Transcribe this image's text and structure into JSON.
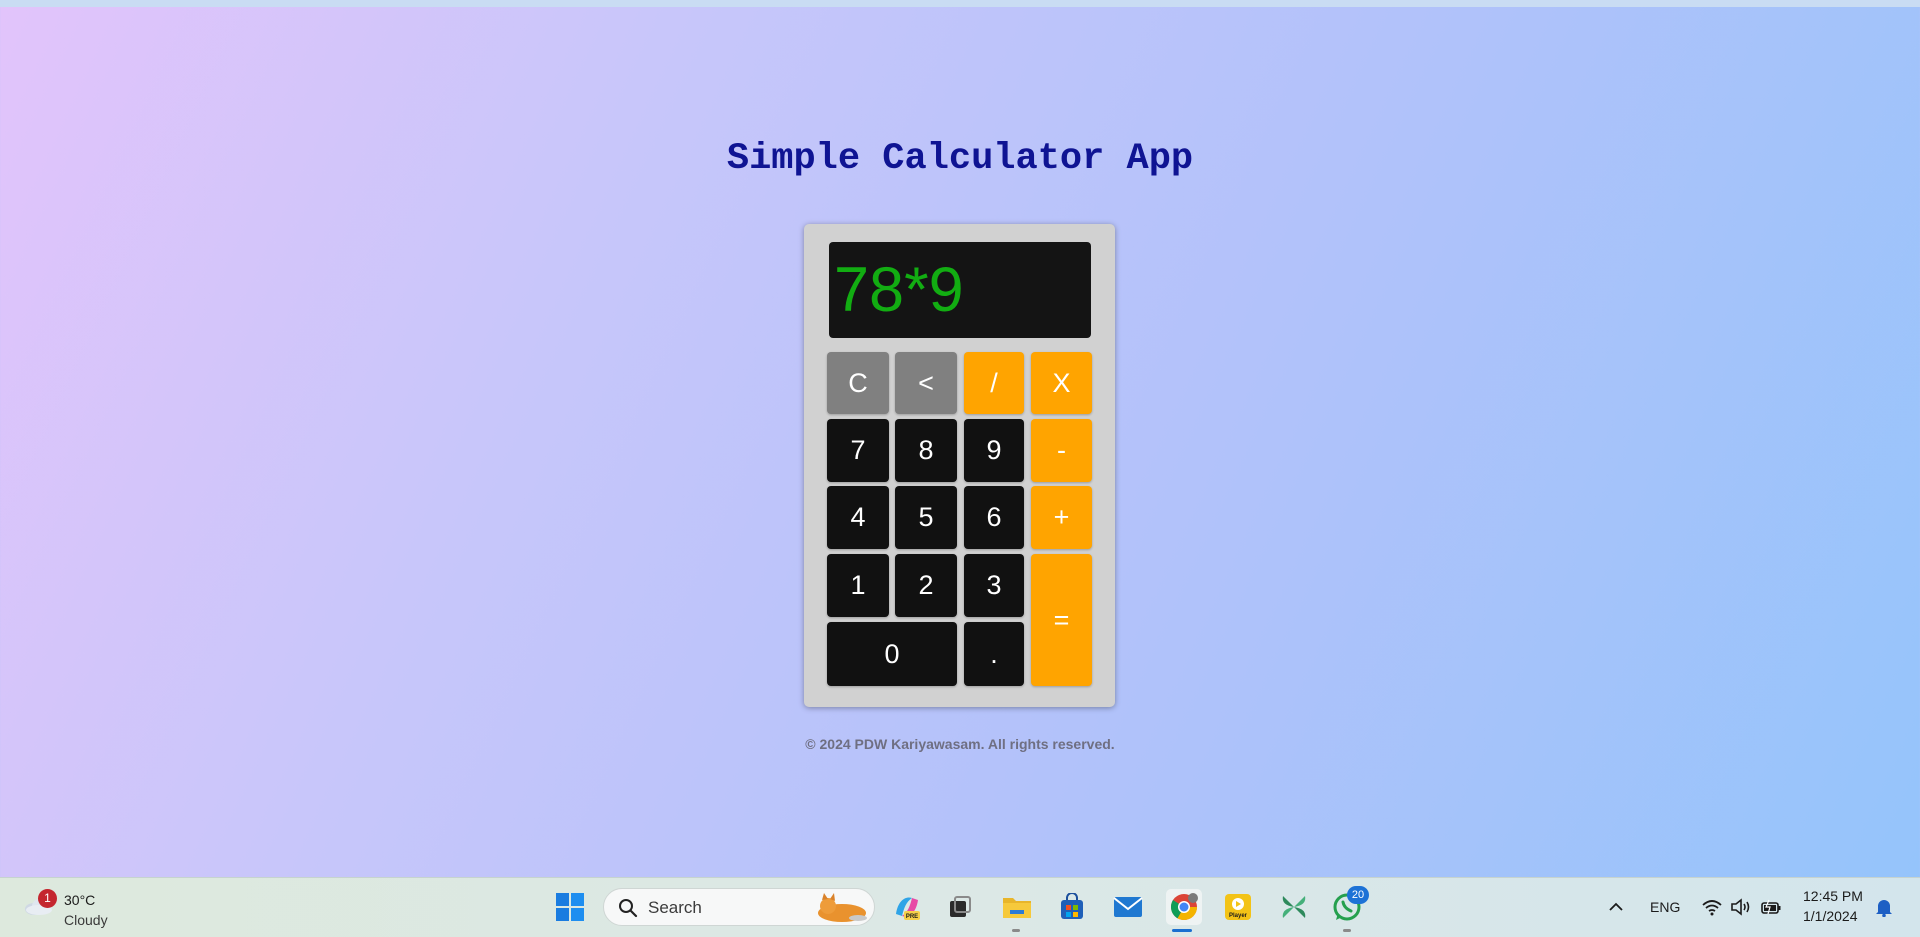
{
  "page": {
    "title": "Simple Calculator App",
    "footer": "© 2024 PDW Kariyawasam. All rights reserved."
  },
  "calculator": {
    "display": "78*9",
    "keys": {
      "clear": "C",
      "backspace": "<",
      "divide": "/",
      "multiply": "X",
      "seven": "7",
      "eight": "8",
      "nine": "9",
      "minus": "-",
      "four": "4",
      "five": "5",
      "six": "6",
      "plus": "+",
      "one": "1",
      "two": "2",
      "three": "3",
      "equals": "=",
      "zero": "0",
      "decimal": "."
    }
  },
  "taskbar": {
    "weather": {
      "temp": "30°C",
      "condition": "Cloudy",
      "badge": "1"
    },
    "search_label": "Search",
    "apps": [
      "start",
      "search",
      "copilot",
      "task-view",
      "file-explorer",
      "microsoft-store",
      "mail",
      "chrome",
      "player",
      "app-green",
      "whatsapp"
    ],
    "whatsapp_badge": "20",
    "language": "ENG",
    "time": "12:45 PM",
    "date": "1/1/2024"
  },
  "colors": {
    "title": "#0f1493",
    "display_text": "#12ad12",
    "operator_key": "#ffa400",
    "function_key": "#808080",
    "digit_key": "#111111"
  }
}
